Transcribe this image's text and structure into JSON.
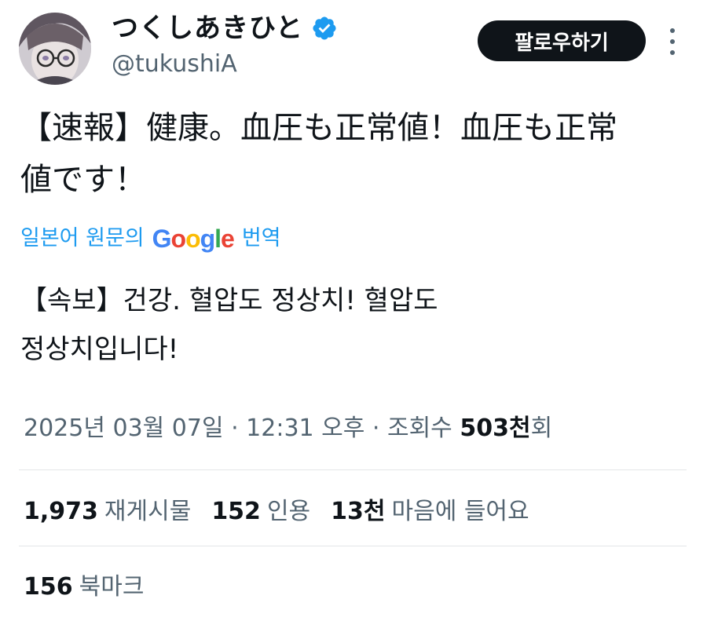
{
  "author": {
    "display_name": "つくしあきひと",
    "handle": "@tukushiA",
    "verified": true,
    "verified_color": "#1d9bf0"
  },
  "follow_button_label": "팔로우하기",
  "tweet": {
    "text": "【速報】健康。血圧も正常値！血圧も正常\n値です！",
    "translate_prefix": "일본어 원문의",
    "translate_brand": [
      "G",
      "o",
      "o",
      "g",
      "l",
      "e"
    ],
    "translate_suffix": "번역",
    "translated_text": "【속보】건강. 혈압도 정상치! 혈압도\n정상치입니다!"
  },
  "meta": {
    "timestamp": "2025년 03월 07일 · 12:31 오후 · 조회수",
    "views_value": "503천",
    "views_unit": "회"
  },
  "stats": {
    "reposts_count": "1,973",
    "reposts_label": "재게시물",
    "quotes_count": "152",
    "quotes_label": "인용",
    "likes_count": "13천",
    "likes_label": "마음에 들어요",
    "bookmarks_count": "156",
    "bookmarks_label": "북마크"
  },
  "colors": {
    "link": "#1d9bf0",
    "text": "#0f1419",
    "secondary": "#536471",
    "button_bg": "#0f1419"
  }
}
